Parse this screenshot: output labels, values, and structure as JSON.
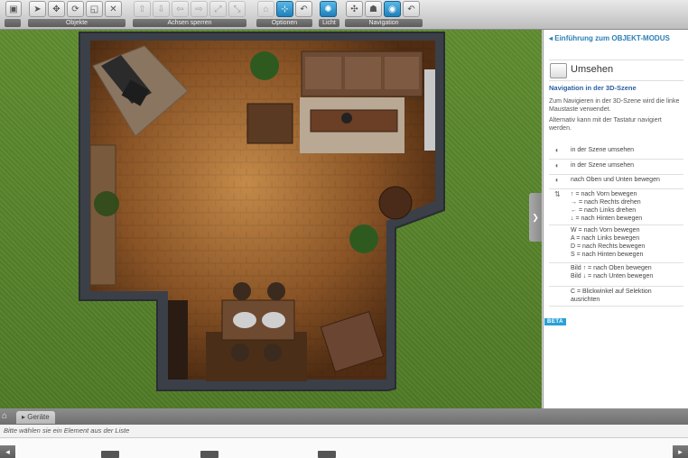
{
  "toolbar": {
    "groups": [
      {
        "label": "",
        "buttons": [
          {
            "icon": "screenshot-icon",
            "state": "normal"
          }
        ]
      },
      {
        "label": "Objekte",
        "buttons": [
          {
            "icon": "pointer-icon",
            "state": "normal"
          },
          {
            "icon": "move-icon",
            "state": "normal"
          },
          {
            "icon": "rotate-icon",
            "state": "normal"
          },
          {
            "icon": "scale-icon",
            "state": "normal"
          },
          {
            "icon": "delete-icon",
            "state": "normal"
          }
        ]
      },
      {
        "label": "Achsen sperren",
        "buttons": [
          {
            "icon": "axis-1-icon",
            "state": "disabled"
          },
          {
            "icon": "axis-2-icon",
            "state": "disabled"
          },
          {
            "icon": "axis-3-icon",
            "state": "disabled"
          },
          {
            "icon": "axis-4-icon",
            "state": "disabled"
          },
          {
            "icon": "axis-5-icon",
            "state": "disabled"
          },
          {
            "icon": "axis-6-icon",
            "state": "disabled"
          }
        ]
      },
      {
        "label": "Optionen",
        "buttons": [
          {
            "icon": "option-1-icon",
            "state": "disabled"
          },
          {
            "icon": "snap-icon",
            "state": "active"
          },
          {
            "icon": "undo-icon",
            "state": "normal"
          }
        ]
      },
      {
        "label": "Licht",
        "buttons": [
          {
            "icon": "light-icon",
            "state": "active"
          }
        ]
      },
      {
        "label": "Navigation",
        "buttons": [
          {
            "icon": "pan-icon",
            "state": "normal"
          },
          {
            "icon": "person-icon",
            "state": "normal"
          },
          {
            "icon": "orbit-icon",
            "state": "active"
          },
          {
            "icon": "reset-view-icon",
            "state": "normal"
          }
        ]
      }
    ]
  },
  "panel": {
    "intro_link": "Einführung zum OBJEKT-MODUS",
    "title": "Umsehen",
    "subtitle": "Navigation in der 3D-Szene",
    "paragraph1": "Zum Navigieren in der 3D-Szene wird die linke Maustaste verwendet.",
    "paragraph2": "Alternativ kann mit der Tastatur navigiert werden.",
    "rows": [
      {
        "icon": "mouse-left-icon",
        "lines": [
          "in der Szene umsehen"
        ]
      },
      {
        "icon": "mouse-right-icon",
        "lines": [
          "in der Szene umsehen"
        ]
      },
      {
        "icon": "mouse-wheel-icon",
        "lines": [
          "nach Oben und Unten bewegen"
        ]
      },
      {
        "icon": "arrow-keys-icon",
        "lines": [
          "↑ = nach Vorn bewegen",
          "→ = nach Rechts drehen",
          "← = nach Links drehen",
          "↓ = nach Hinten bewegen"
        ]
      },
      {
        "icon": "",
        "lines": [
          "W = nach Vorn bewegen",
          "A = nach Links bewegen",
          "D = nach Rechts bewegen",
          "S = nach Hinten bewegen"
        ]
      },
      {
        "icon": "",
        "lines": [
          "Bild ↑ = nach Oben bewegen",
          "Bild ↓ = nach Unten bewegen"
        ]
      },
      {
        "icon": "",
        "lines": [
          "C = Blickwinkel auf Selektion",
          "ausrichten"
        ]
      }
    ],
    "badge": "BETA"
  },
  "bottom": {
    "tab_label": "Geräte",
    "status_text": "Bitte wählen sie ein Element aus der Liste"
  },
  "colors": {
    "accent": "#2a7fb5",
    "active_button": "#1f7fb8",
    "grass": "#5d8a2e",
    "floor": "#8b5a2b"
  }
}
